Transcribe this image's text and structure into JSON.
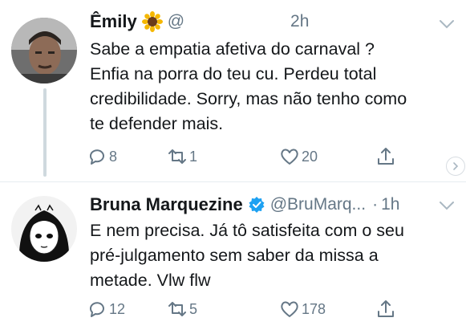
{
  "tweets": [
    {
      "name": "Êmily",
      "handle": "@",
      "time": "2h",
      "lines": [
        "Sabe a empatia afetiva do carnaval ?",
        "Enfia na porra do teu cu. Perdeu total",
        "credibilidade. Sorry, mas não tenho como",
        "te defender mais."
      ],
      "replies": "8",
      "retweets": "1",
      "likes": "20"
    },
    {
      "name": "Bruna Marquezine",
      "handle": "@BruMarq...",
      "sep": "·",
      "time": "1h",
      "lines": [
        "E nem precisa. Já tô satisfeita com o seu",
        "pré-julgamento sem saber da missa a",
        "metade. Vlw flw"
      ],
      "replies": "12",
      "retweets": "5",
      "likes": "178"
    }
  ],
  "colors": {
    "text": "#14171a",
    "muted": "#657786",
    "verified": "#1da1f2",
    "thread_line": "#cfd9de"
  },
  "icons": [
    "reply-icon",
    "retweet-icon",
    "like-icon",
    "share-icon",
    "chevron-down-icon",
    "verified-badge-icon",
    "sunflower-emoji"
  ]
}
